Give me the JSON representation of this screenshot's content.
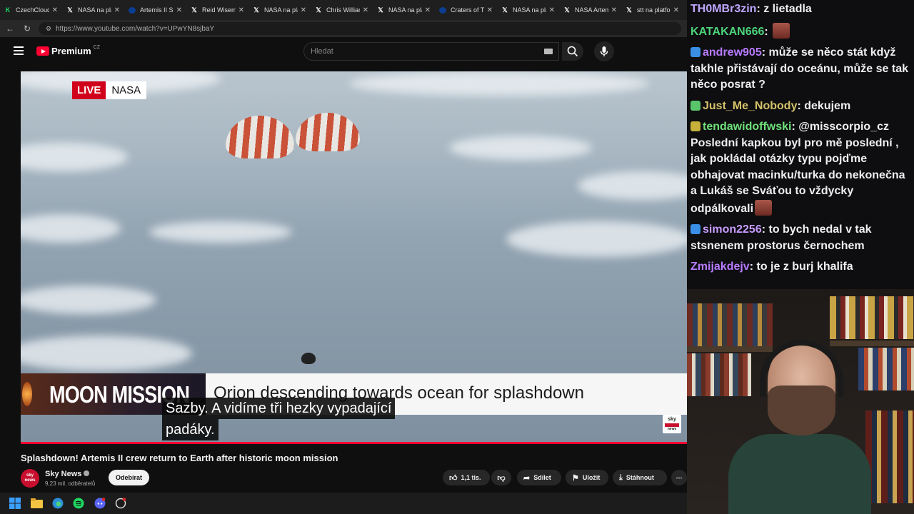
{
  "browser": {
    "tabs": [
      {
        "title": "CzechCloud S",
        "icon": "czechcloud-icon"
      },
      {
        "title": "NASA na platf",
        "icon": "x-icon"
      },
      {
        "title": "Artemis II Spl",
        "icon": "nasa-icon"
      },
      {
        "title": "Reid Wiseman",
        "icon": "x-icon"
      },
      {
        "title": "NASA na platf",
        "icon": "x-icon"
      },
      {
        "title": "Chris Williams",
        "icon": "x-icon"
      },
      {
        "title": "NASA na platf",
        "icon": "x-icon"
      },
      {
        "title": "Craters of Tim",
        "icon": "nasa-icon"
      },
      {
        "title": "NASA na platf",
        "icon": "x-icon"
      },
      {
        "title": "NASA Artemis",
        "icon": "x-icon"
      },
      {
        "title": "stt na platform",
        "icon": "x-icon"
      }
    ],
    "url": "https://www.youtube.com/watch?v=UPwYN8sjbaY"
  },
  "youtube": {
    "logo_text": "Premium",
    "region": "CZ",
    "search_placeholder": "Hledat"
  },
  "video": {
    "live_label": "LIVE",
    "live_source": "NASA",
    "lower_third_tag": "MOON MISSION",
    "lower_third_headline": "Orion descending towards ocean for splashdown",
    "caption_line1": "Sazby.  A vidíme tři hezky vypadající",
    "caption_line2": "padáky.",
    "channel_logo_top": "sky",
    "channel_logo_bottom": "news"
  },
  "details": {
    "title": "Splashdown! Artemis II crew return to Earth after historic moon mission",
    "channel": "Sky News",
    "avatar_text": "sky news",
    "subscribers": "9,23 mil. odběratelů",
    "subscribe_label": "Odebírat",
    "likes": "1,1 tis.",
    "share_label": "Sdílet",
    "save_label": "Uložit",
    "download_label": "Stáhnout"
  },
  "chat": {
    "messages": [
      {
        "user": "TH0MBr3zin",
        "color": "#bfa7ff",
        "text": "z lietadla"
      },
      {
        "user": "KATAKAN666",
        "color": "#4cd37a",
        "text": ""
      },
      {
        "user": "andrew905",
        "color": "#b77bff",
        "text": "může se něco stát když takhle přistávají do oceánu, může se tak něco posrat ?"
      },
      {
        "user": "Just_Me_Nobody",
        "color": "#d6c26a",
        "text": "dekujem"
      },
      {
        "user": "tendawidoffwski",
        "color": "#6fe07a",
        "text": "@misscorpio_cz Poslední kapkou byl pro mě poslední , jak pokládal otázky typu pojďme obhajovat macinku/turka do nekonečna a Lukáš se Sváťou to vždycky odpálkovali"
      },
      {
        "user": "simon2256",
        "color": "#c79bff",
        "text": "to bych nedal v tak stsnenem prostorus černochem"
      },
      {
        "user": "Zmijakdejv",
        "color": "#b77bff",
        "text": "to je z burj khalifa"
      }
    ]
  }
}
